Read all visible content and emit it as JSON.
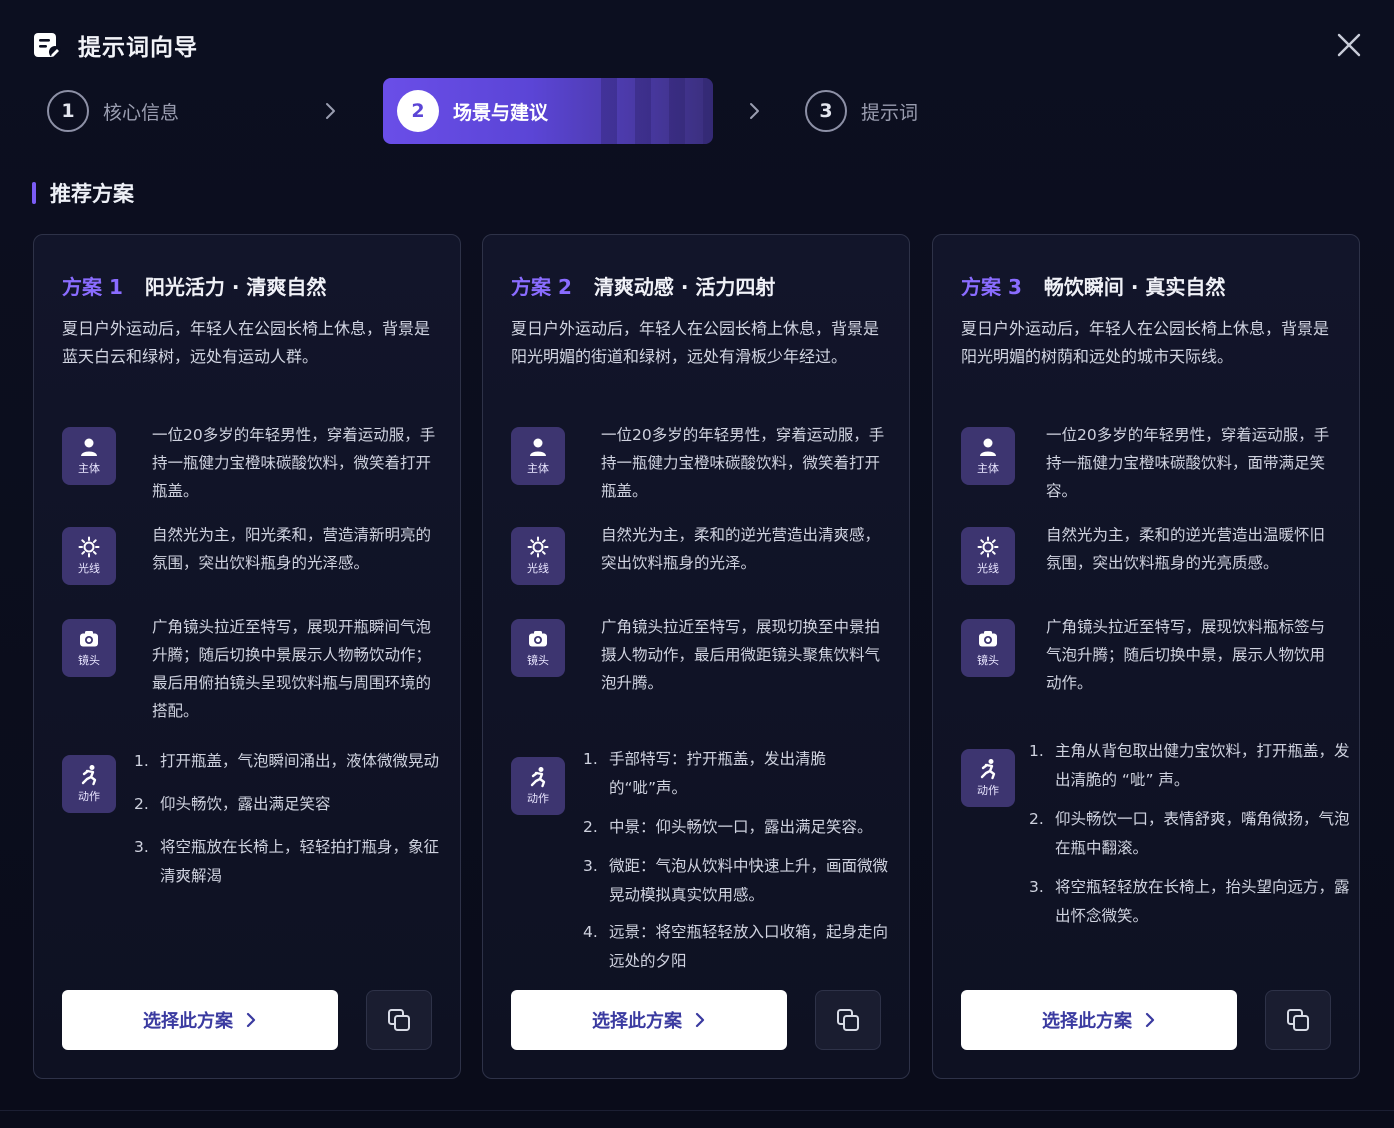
{
  "header": {
    "title": "提示词向导"
  },
  "steps": [
    {
      "num": "1",
      "label": "核心信息"
    },
    {
      "num": "2",
      "label": "场景与建议"
    },
    {
      "num": "3",
      "label": "提示词"
    }
  ],
  "section": {
    "title": "推荐方案"
  },
  "badges": {
    "subject": "主体",
    "light": "光线",
    "lens": "镜头",
    "action": "动作"
  },
  "cards": [
    {
      "tag": "方案 1",
      "title": "阳光活力 · 清爽自然",
      "desc": "夏日户外运动后，年轻人在公园长椅上休息，背景是蓝天白云和绿树，远处有运动人群。",
      "subject": "一位20多岁的年轻男性，穿着运动服，手持一瓶健力宝橙味碳酸饮料，微笑着打开瓶盖。",
      "light": "自然光为主，阳光柔和，营造清新明亮的氛围，突出饮料瓶身的光泽感。",
      "lens": "广角镜头拉近至特写，展现开瓶瞬间气泡升腾；随后切换中景展示人物畅饮动作；最后用俯拍镜头呈现饮料瓶与周围环境的搭配。",
      "actions": [
        {
          "num": "1.",
          "text": "打开瓶盖，气泡瞬间涌出，液体微微晃动"
        },
        {
          "num": "2.",
          "text": "仰头畅饮，露出满足笑容"
        },
        {
          "num": "3.",
          "text": "将空瓶放在长椅上，轻轻拍打瓶身，象征清爽解渴"
        }
      ],
      "select_label": "选择此方案"
    },
    {
      "tag": "方案 2",
      "title": "清爽动感 · 活力四射",
      "desc": "夏日户外运动后，年轻人在公园长椅上休息，背景是阳光明媚的街道和绿树，远处有滑板少年经过。",
      "subject": "一位20多岁的年轻男性，穿着运动服，手持一瓶健力宝橙味碳酸饮料，微笑着打开瓶盖。",
      "light": "自然光为主，柔和的逆光营造出清爽感，突出饮料瓶身的光泽。",
      "lens": "广角镜头拉近至特写，展现切换至中景拍摄人物动作，最后用微距镜头聚焦饮料气泡升腾。",
      "actions": [
        {
          "num": "1.",
          "text": "手部特写：拧开瓶盖，发出清脆的“呲”声。"
        },
        {
          "num": "2.",
          "text": "中景：仰头畅饮一口，露出满足笑容。"
        },
        {
          "num": "3.",
          "text": "微距：气泡从饮料中快速上升，画面微微晃动模拟真实饮用感。"
        },
        {
          "num": "4.",
          "text": "远景：将空瓶轻轻放入口收箱，起身走向远处的夕阳"
        }
      ],
      "select_label": "选择此方案"
    },
    {
      "tag": "方案 3",
      "title": "畅饮瞬间 · 真实自然",
      "desc": "夏日户外运动后，年轻人在公园长椅上休息，背景是阳光明媚的树荫和远处的城市天际线。",
      "subject": "一位20多岁的年轻男性，穿着运动服，手持一瓶健力宝橙味碳酸饮料，面带满足笑容。",
      "light": "自然光为主，柔和的逆光营造出温暖怀旧氛围，突出饮料瓶身的光亮质感。",
      "lens": "广角镜头拉近至特写，展现饮料瓶标签与气泡升腾；随后切换中景，展示人物饮用动作。",
      "actions": [
        {
          "num": "1.",
          "text": "主角从背包取出健力宝饮料，打开瓶盖，发出清脆的 “呲” 声。"
        },
        {
          "num": "2.",
          "text": "仰头畅饮一口，表情舒爽，嘴角微扬，气泡在瓶中翻滚。"
        },
        {
          "num": "3.",
          "text": "将空瓶轻轻放在长椅上，抬头望向远方，露出怀念微笑。"
        }
      ],
      "select_label": "选择此方案"
    }
  ]
}
